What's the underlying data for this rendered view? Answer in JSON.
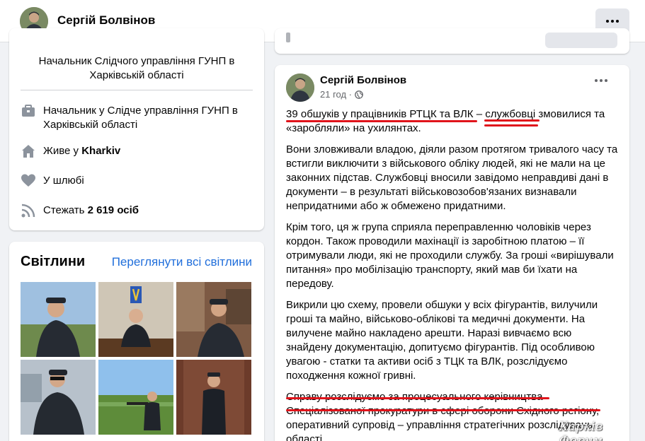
{
  "header": {
    "profile_name": "Сергій Болвінов"
  },
  "intro": {
    "bio": "Начальник Слідчого управління ГУНП в Харківській області",
    "work": "Начальник у Слідче управління ГУНП в Харківській області",
    "lives_prefix": "Живе у ",
    "lives_city": "Kharkiv",
    "relationship": "У шлюбі",
    "followers_prefix": "Стежать ",
    "followers_count": "2 619 осіб"
  },
  "photos": {
    "title": "Світлини",
    "see_all": "Переглянути всі світлини"
  },
  "post": {
    "author": "Сергій Болвінов",
    "time": "21 год ·",
    "para1": "39 обшуків у працівників РТЦК та ВЛК – службовці змовилися та «заробляли» на ухилянтах.",
    "para2": "Вони зловживали владою, діяли разом протягом тривалого часу та встигли виключити з військового обліку людей, які не мали на це законних підстав. Службовці вносили завідомо неправдиві дані в документи – в результаті військовозобов'язаних визнавали непридатними або ж обмежено придатними.",
    "para3": "Крім того, ця ж група сприяла переправленню чоловіків через кордон. Також проводили махінації із заробітною платою – її отримували люди, які не проходили службу. За гроші «вирішували питання» про мобілізацію транспорту, який мав би їхати на передову.",
    "para4": "Викрили цю схему, провели обшуки у всіх фігурантів, вилучили гроші та майно, військово-облікові та медичні  документи. На вилучене майно накладено арешти. Наразі вивчаємо всю знайдену документацію, допитуємо фігурантів. Під особливою увагою - статки та активи осіб з ТЦК та ВЛК, розслідуємо походження кожної гривні.",
    "para5": "Справу розслідуємо за процесуального керівництва Спеціалізованої прокуратури в сфері оборони Східного регіону, оперативний супровід – управління стратегічних розслідувань області."
  },
  "watermark": "Харків Форум",
  "colors": {
    "link": "#216fdb",
    "annotation_red": "#e0141b"
  }
}
